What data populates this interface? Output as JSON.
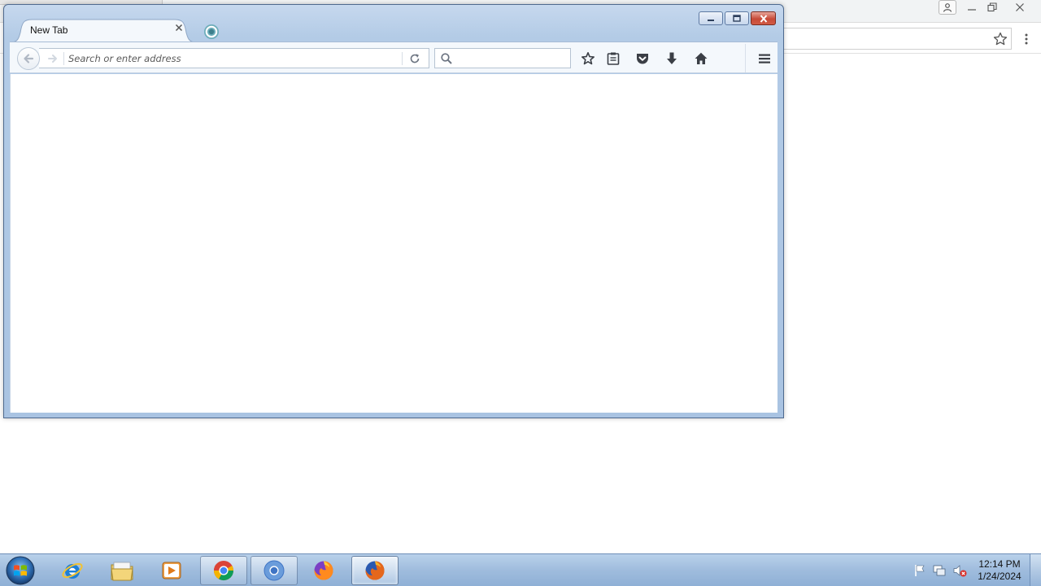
{
  "browser": {
    "tab": {
      "title": "New Tab",
      "close_label": "×"
    },
    "urlbar": {
      "placeholder": "Search or enter address",
      "value": ""
    },
    "searchbar": {
      "placeholder": "",
      "value": ""
    }
  },
  "taskbar": {
    "clock": {
      "time": "12:14 PM",
      "date": "1/24/2024"
    }
  },
  "colors": {
    "firefox_frame": "#a9c3e2",
    "taskbar": "#9fbcdd",
    "close_button": "#c74a38"
  },
  "icons": {
    "toolbar": [
      "star-icon",
      "reading-list-icon",
      "pocket-icon",
      "download-icon",
      "home-icon",
      "hamburger-menu-icon"
    ],
    "taskbar_apps": [
      "windows-start-icon",
      "internet-explorer-icon",
      "file-explorer-icon",
      "media-player-icon",
      "chrome-icon",
      "chromium-icon",
      "firefox-icon",
      "firefox-active-icon"
    ],
    "tray": [
      "action-center-flag-icon",
      "network-icon",
      "volume-muted-icon"
    ]
  }
}
